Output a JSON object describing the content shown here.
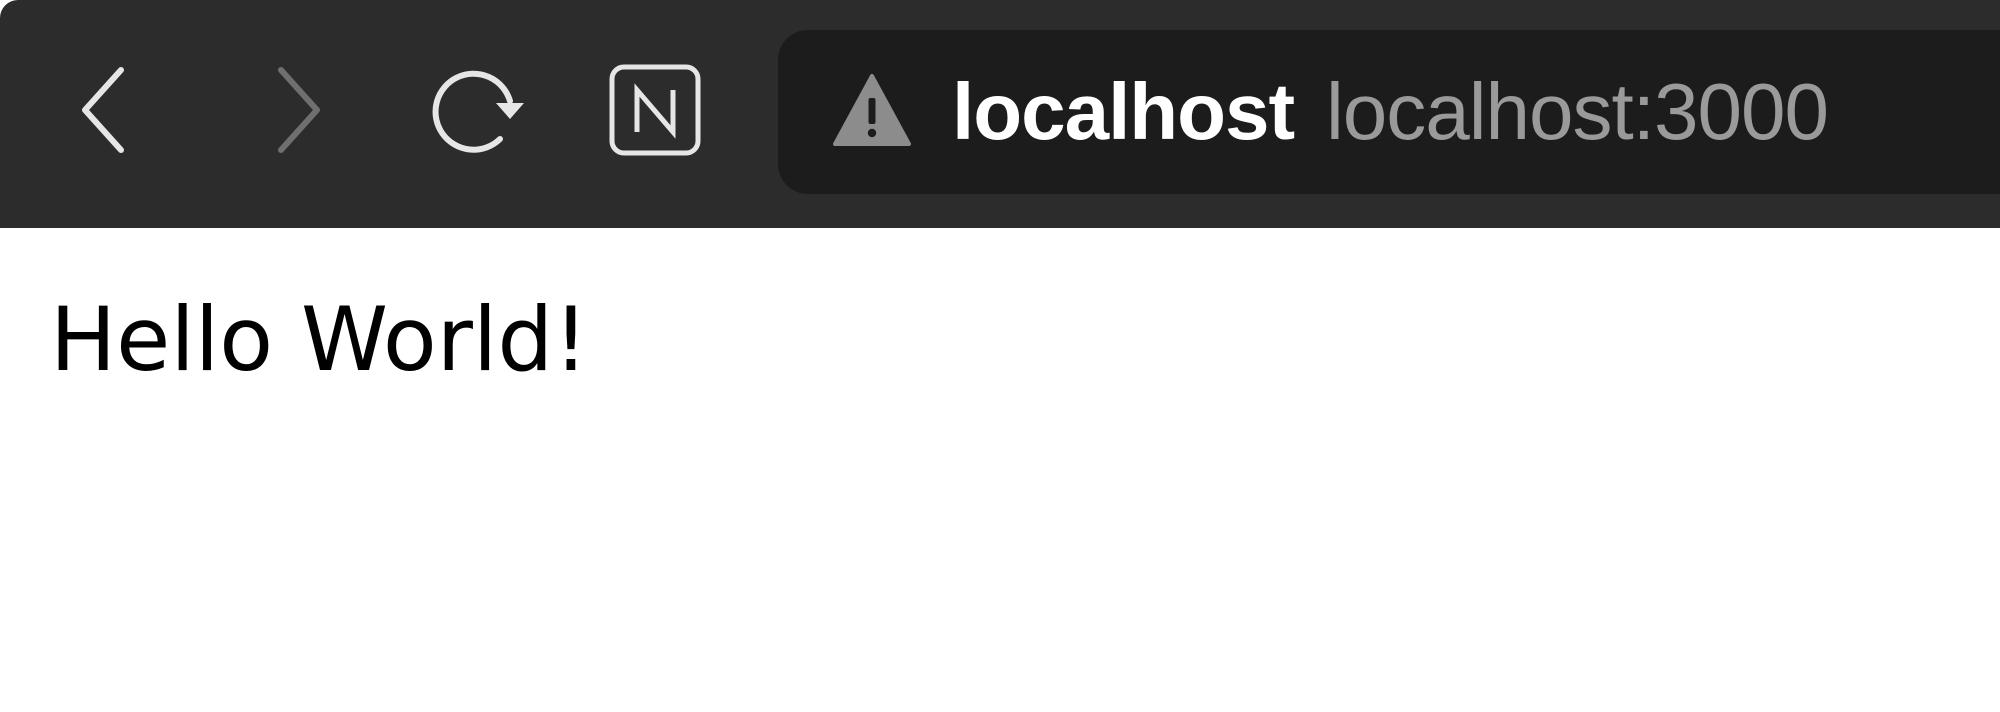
{
  "browser": {
    "toolbar": {
      "back_icon": "chevron-left-icon",
      "forward_icon": "chevron-right-icon",
      "reload_icon": "reload-icon",
      "extension_icon": "n-badge-icon",
      "back_enabled": true,
      "forward_enabled": false
    },
    "address_bar": {
      "security_icon": "warning-triangle-icon",
      "host": "localhost",
      "url": "localhost:3000"
    },
    "colors": {
      "toolbar_bg": "#2c2c2c",
      "address_bar_bg": "#1c1c1c",
      "host_text": "#ffffff",
      "url_text": "#9a9a9a",
      "icon_active": "#e6e6e6",
      "icon_disabled": "#6f6f6f",
      "warning_icon": "#8c8c8c"
    }
  },
  "page": {
    "greeting": "Hello World!"
  }
}
